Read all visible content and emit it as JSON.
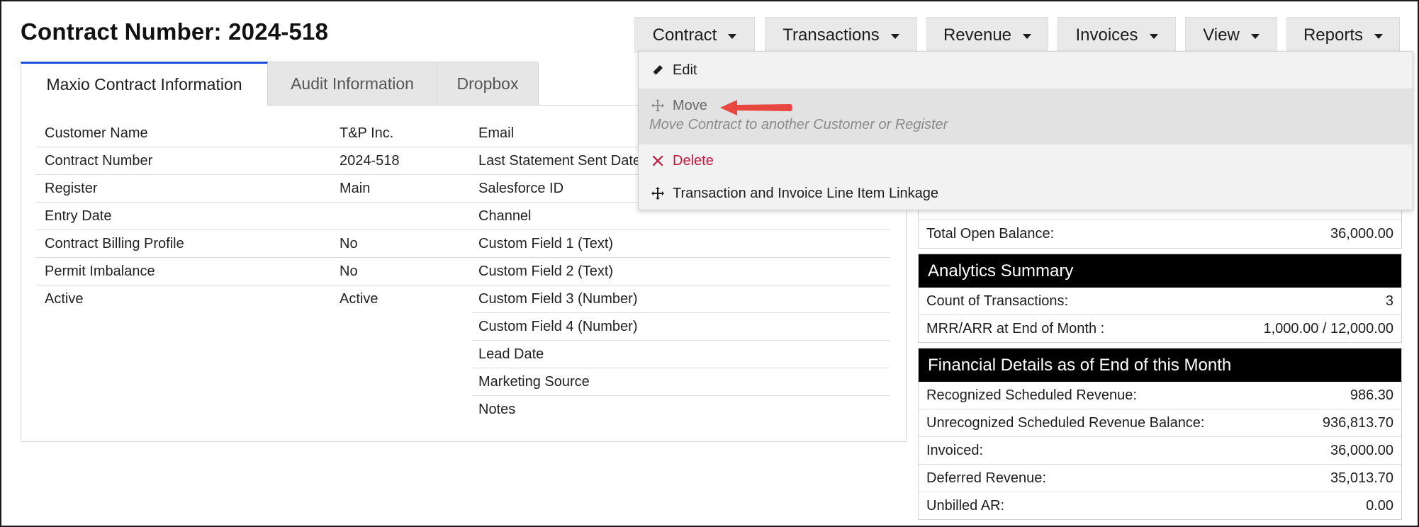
{
  "page_title": "Contract Number: 2024-518",
  "top_buttons": [
    {
      "label": "Contract"
    },
    {
      "label": "Transactions"
    },
    {
      "label": "Revenue"
    },
    {
      "label": "Invoices"
    },
    {
      "label": "View"
    },
    {
      "label": "Reports"
    }
  ],
  "tabs": [
    {
      "label": "Maxio Contract Information",
      "active": true
    },
    {
      "label": "Audit Information"
    },
    {
      "label": "Dropbox"
    }
  ],
  "left_fields": [
    {
      "label": "Customer Name",
      "value": "T&P Inc.",
      "link": true
    },
    {
      "label": "Contract Number",
      "value": "2024-518"
    },
    {
      "label": "Register",
      "value": "Main",
      "link": true
    },
    {
      "label": "Entry Date",
      "value": ""
    },
    {
      "label": "Contract Billing Profile",
      "value": "No"
    },
    {
      "label": "Permit Imbalance",
      "value": "No"
    },
    {
      "label": "Active",
      "value": "Active"
    }
  ],
  "middle_fields": [
    {
      "label": "Email"
    },
    {
      "label": "Last Statement Sent Date"
    },
    {
      "label": "Salesforce ID"
    },
    {
      "label": "Channel"
    },
    {
      "label": "Custom Field 1 (Text)"
    },
    {
      "label": "Custom Field 2 (Text)"
    },
    {
      "label": "Custom Field 3 (Number)"
    },
    {
      "label": "Custom Field 4 (Number)"
    },
    {
      "label": "Lead Date"
    },
    {
      "label": "Marketing Source"
    },
    {
      "label": "Notes"
    }
  ],
  "balance_box": {
    "rows": [
      {
        "label": "Total Open Balance:",
        "value": "36,000.00"
      }
    ]
  },
  "analytics": {
    "title": "Analytics Summary",
    "rows": [
      {
        "label": "Count of Transactions:",
        "value": "3"
      },
      {
        "label": "MRR/ARR at End of Month :",
        "value": "1,000.00 / 12,000.00"
      }
    ]
  },
  "financial": {
    "title": "Financial Details as of End of this Month",
    "rows": [
      {
        "label": "Recognized Scheduled Revenue:",
        "value": "986.30"
      },
      {
        "label": "Unrecognized Scheduled Revenue Balance:",
        "value": "936,813.70"
      },
      {
        "label": "Invoiced:",
        "value": "36,000.00"
      },
      {
        "label": "Deferred Revenue:",
        "value": "35,013.70"
      },
      {
        "label": "Unbilled AR:",
        "value": "0.00"
      }
    ]
  },
  "dropdown": {
    "edit": "Edit",
    "move": "Move",
    "move_sub": "Move Contract to another Customer or Register",
    "delete": "Delete",
    "linkage": "Transaction and Invoice Line Item Linkage"
  },
  "colors": {
    "link": "#1f5fd1",
    "active_tab_border": "#1f4fd6",
    "delete": "#c3173f",
    "arrow": "#e8473f",
    "header_bg": "#000000"
  }
}
